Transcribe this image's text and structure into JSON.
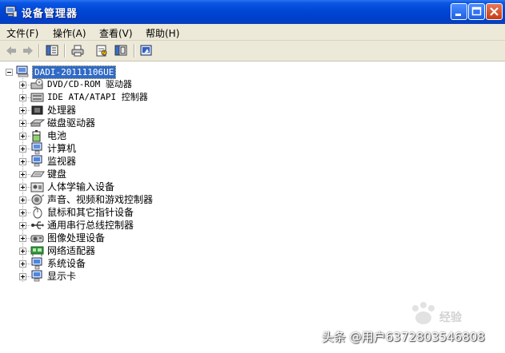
{
  "window": {
    "title": "设备管理器"
  },
  "menu": {
    "file": "文件(F)",
    "action": "操作(A)",
    "view": "查看(V)",
    "help": "帮助(H)"
  },
  "toolbar": {
    "icons": [
      "back-arrow-icon",
      "forward-arrow-icon",
      "show-hide-tree-icon",
      "print-icon",
      "properties-icon",
      "export-list-icon",
      "help-icon"
    ]
  },
  "tree": {
    "root": "DADI-20111106UE",
    "items": [
      {
        "label": "DVD/CD-ROM 驱动器",
        "icon": "dvd-drive-icon"
      },
      {
        "label": "IDE ATA/ATAPI 控制器",
        "icon": "ide-controller-icon"
      },
      {
        "label": "处理器",
        "icon": "processor-icon"
      },
      {
        "label": "磁盘驱动器",
        "icon": "disk-drive-icon"
      },
      {
        "label": "电池",
        "icon": "battery-icon"
      },
      {
        "label": "计算机",
        "icon": "computer-icon"
      },
      {
        "label": "监视器",
        "icon": "monitor-icon"
      },
      {
        "label": "键盘",
        "icon": "keyboard-icon"
      },
      {
        "label": "人体学输入设备",
        "icon": "hid-icon"
      },
      {
        "label": "声音、视频和游戏控制器",
        "icon": "sound-icon"
      },
      {
        "label": "鼠标和其它指针设备",
        "icon": "mouse-icon"
      },
      {
        "label": "通用串行总线控制器",
        "icon": "usb-icon"
      },
      {
        "label": "图像处理设备",
        "icon": "imaging-icon"
      },
      {
        "label": "网络适配器",
        "icon": "network-adapter-icon"
      },
      {
        "label": "系统设备",
        "icon": "system-device-icon"
      },
      {
        "label": "显示卡",
        "icon": "display-adapter-icon"
      }
    ]
  },
  "overlay": {
    "watermark": "Bai 经验",
    "credit": "头条 @用户6372803546808"
  },
  "colors": {
    "titlebar": "#0046d5",
    "selection": "#316ac5",
    "chrome": "#ece9d8"
  }
}
